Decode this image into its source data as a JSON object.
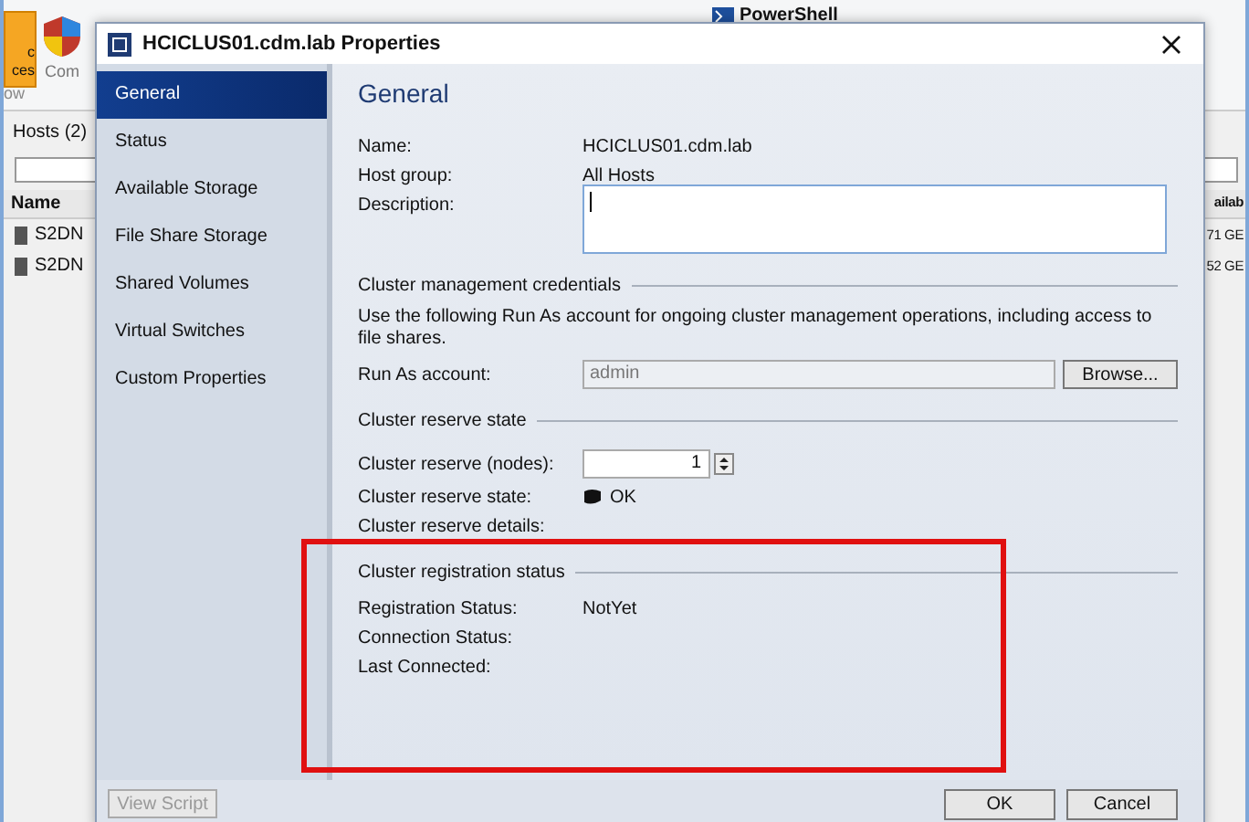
{
  "background_app": {
    "ribbon_button": {
      "lines": [
        "c",
        "ces"
      ]
    },
    "ribbon_items": [
      {
        "label": "Com"
      },
      {
        "label": "PowerShell"
      }
    ],
    "ribbon_group_label": "ow",
    "hosts_tab": "Hosts (2)",
    "table": {
      "columns": [
        "Name",
        "ailab"
      ],
      "rows": [
        {
          "name": "S2DN",
          "available": "71 GE"
        },
        {
          "name": "S2DN",
          "available": "52 GE"
        }
      ]
    }
  },
  "dialog": {
    "title": "HCICLUS01.cdm.lab Properties",
    "nav": [
      {
        "label": "General",
        "selected": true
      },
      {
        "label": "Status",
        "selected": false
      },
      {
        "label": "Available Storage",
        "selected": false
      },
      {
        "label": "File Share Storage",
        "selected": false
      },
      {
        "label": "Shared Volumes",
        "selected": false
      },
      {
        "label": "Virtual Switches",
        "selected": false
      },
      {
        "label": "Custom Properties",
        "selected": false
      }
    ],
    "heading": "General",
    "fields": [
      {
        "label": "Name:",
        "value": "HCICLUS01.cdm.lab"
      },
      {
        "label": "Host group:",
        "value": "All Hosts"
      },
      {
        "label": "Description:",
        "kind": "textarea"
      }
    ],
    "sections": [
      {
        "title": "Cluster management credentials",
        "note": "Use the following Run As account for ongoing cluster management operations, including access to file shares.",
        "rows": [
          {
            "kind": "account",
            "label": "Run As account:",
            "value": "admin",
            "disabled": true,
            "button": "Browse..."
          }
        ]
      },
      {
        "title": "Cluster reserve state",
        "rows": [
          {
            "kind": "spinner",
            "label": "Cluster reserve (nodes):",
            "value": "1"
          },
          {
            "kind": "status",
            "label": "Cluster reserve state:",
            "value": "OK"
          },
          {
            "kind": "text",
            "label": "Cluster reserve details:"
          }
        ]
      },
      {
        "title": "Cluster registration status",
        "rows": [
          {
            "kind": "text",
            "label": "Registration Status:",
            "value": "NotYet"
          },
          {
            "kind": "text",
            "label": "Connection Status:"
          },
          {
            "kind": "text",
            "label": "Last Connected:"
          }
        ]
      }
    ],
    "footer": {
      "view_script": {
        "label": "View Script",
        "disabled": true
      },
      "buttons": [
        "OK",
        "Cancel"
      ]
    }
  },
  "highlight": {
    "visible": true
  }
}
